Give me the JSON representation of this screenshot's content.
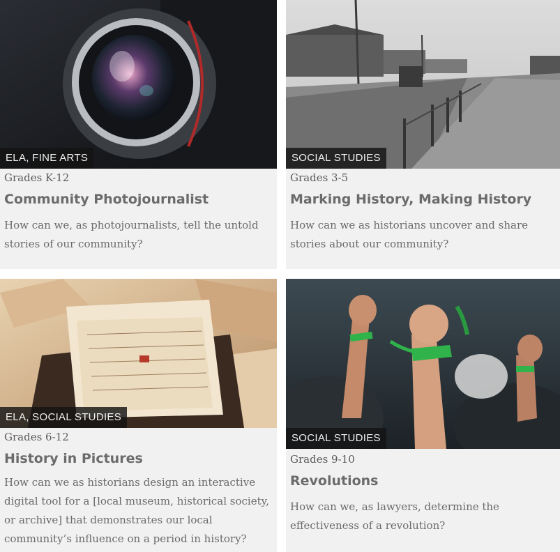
{
  "cards": [
    {
      "category": "ELA, FINE ARTS",
      "grades": "Grades K-12",
      "title": "Community Photojournalist",
      "question": "How can we, as photojournalists, tell the untold stories of our community?"
    },
    {
      "category": "SOCIAL STUDIES",
      "grades": "Grades 3-5",
      "title": "Marking History, Making History",
      "question": "How can we as historians uncover and share stories about our community?"
    },
    {
      "category": "ELA, SOCIAL STUDIES",
      "grades": "Grades 6-12",
      "title": "History in Pictures",
      "question": "How can we as historians design an interactive digital tool for a [local museum, historical society, or archive] that demonstrates our local community’s influence on a period in history?"
    },
    {
      "category": "SOCIAL STUDIES",
      "grades": "Grades 9-10",
      "title": "Revolutions",
      "question": "How can we, as lawyers, determine the effectiveness of a revolution?"
    }
  ],
  "colors": {
    "card_bg": "#f1f1f1",
    "badge_bg": "#1a1a1a",
    "title_text": "#6b6b6b",
    "ribbon_green": "#2fb34a"
  },
  "icons": [
    "camera-lens-photo",
    "historic-street-photo",
    "old-letters-photo",
    "protest-fists-photo"
  ]
}
